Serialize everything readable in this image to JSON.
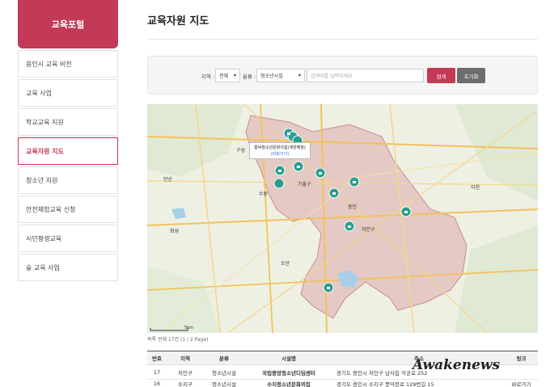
{
  "sidebar": {
    "title": "교육포털",
    "items": [
      {
        "label": "용인시 교육 비전",
        "active": false
      },
      {
        "label": "교육 사업",
        "active": false
      },
      {
        "label": "학교교육 지원",
        "active": false
      },
      {
        "label": "교육자원 지도",
        "active": true
      },
      {
        "label": "청소년 지원",
        "active": false
      },
      {
        "label": "안전체험교육 신청",
        "active": false
      },
      {
        "label": "시민평생교육",
        "active": false
      },
      {
        "label": "숲 교육 사업",
        "active": false
      }
    ]
  },
  "main": {
    "title": "교육자원 지도",
    "search": {
      "region_label": "지역 :",
      "region_value": "전체",
      "category_label": "분류 :",
      "category_value": "청소년시설",
      "keyword_placeholder": "검색어를 입력하세요",
      "search_button": "검색",
      "reset_button": "초기화"
    },
    "map": {
      "tooltip_title": "흥덕청소년문화의집(계관예정)",
      "tooltip_link": "(바로가기)",
      "scale_label": "5km",
      "place_labels": [
        "구성",
        "수원",
        "기흥구",
        "처인구",
        "용인",
        "오산",
        "이천",
        "안산",
        "화성"
      ]
    },
    "result_count": "목록 전체 17건 (1 / 2 Page)",
    "table": {
      "headers": [
        "번호",
        "지역",
        "분류",
        "시설명",
        "주소",
        "링크"
      ],
      "rows": [
        {
          "no": "17",
          "region": "처인구",
          "category": "청소년시설",
          "name": "국립중앙청소년디딤센터",
          "address": "경기도 용인시 처인구 남사읍 각궁로 252",
          "link": ""
        },
        {
          "no": "16",
          "region": "수지구",
          "category": "청소년시설",
          "name": "수지청소년문화의집",
          "address": "경기도 용인시 수지구 풍덕천로 129번길 15",
          "link": "바로가기"
        }
      ]
    },
    "watermark": "Awakenews"
  }
}
